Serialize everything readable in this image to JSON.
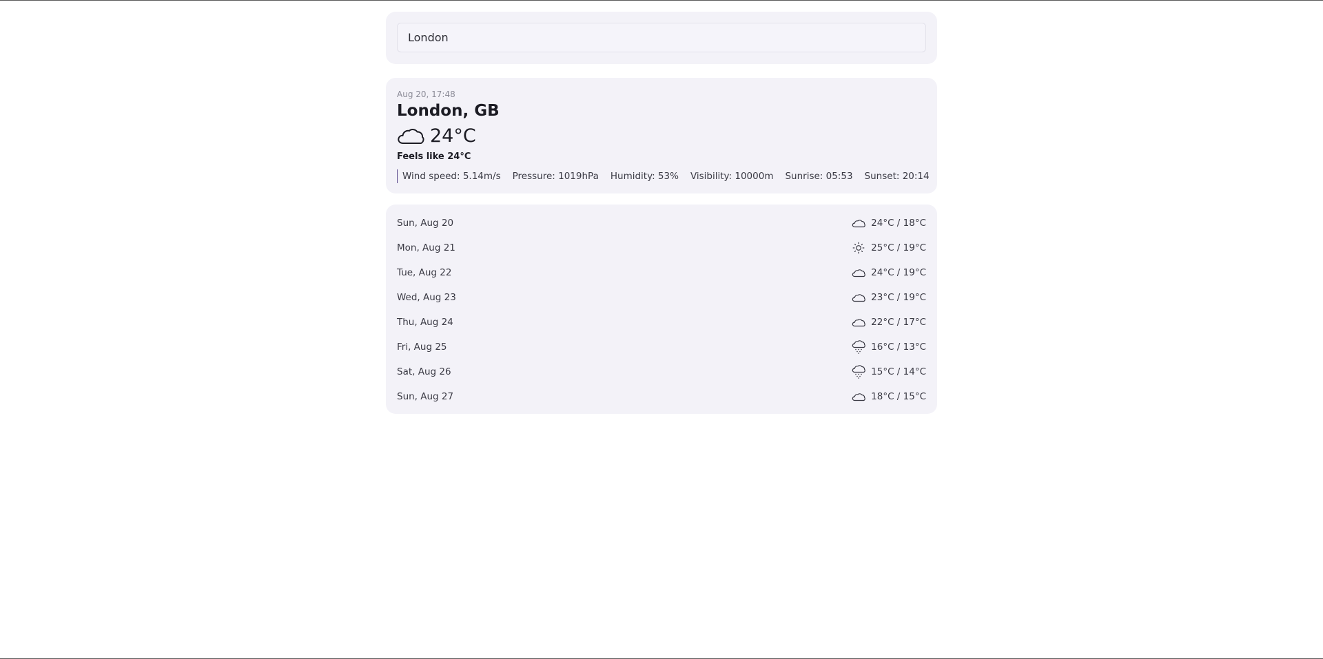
{
  "search": {
    "value": "London"
  },
  "current": {
    "date": "Aug 20, 17:48",
    "city": "London, GB",
    "icon": "cloud-icon",
    "temperature": "24°C",
    "feels_like": "Feels like 24°C",
    "details": {
      "wind_speed": "Wind speed: 5.14m/s",
      "pressure": "Pressure: 1019hPa",
      "humidity": "Humidity: 53%",
      "visibility": "Visibility: 10000m",
      "sunrise": "Sunrise: 05:53",
      "sunset": "Sunset: 20:14"
    },
    "accent_color": "#5b4a8c"
  },
  "forecast": [
    {
      "day": "Sun, Aug 20",
      "icon": "cloud-icon",
      "temps": "24°C / 18°C"
    },
    {
      "day": "Mon, Aug 21",
      "icon": "sun-icon",
      "temps": "25°C / 19°C"
    },
    {
      "day": "Tue, Aug 22",
      "icon": "cloud-icon",
      "temps": "24°C / 19°C"
    },
    {
      "day": "Wed, Aug 23",
      "icon": "cloud-icon",
      "temps": "23°C / 19°C"
    },
    {
      "day": "Thu, Aug 24",
      "icon": "cloud-icon",
      "temps": "22°C / 17°C"
    },
    {
      "day": "Fri, Aug 25",
      "icon": "rain-icon",
      "temps": "16°C / 13°C"
    },
    {
      "day": "Sat, Aug 26",
      "icon": "rain-icon",
      "temps": "15°C / 14°C"
    },
    {
      "day": "Sun, Aug 27",
      "icon": "cloud-icon",
      "temps": "18°C / 15°C"
    }
  ]
}
